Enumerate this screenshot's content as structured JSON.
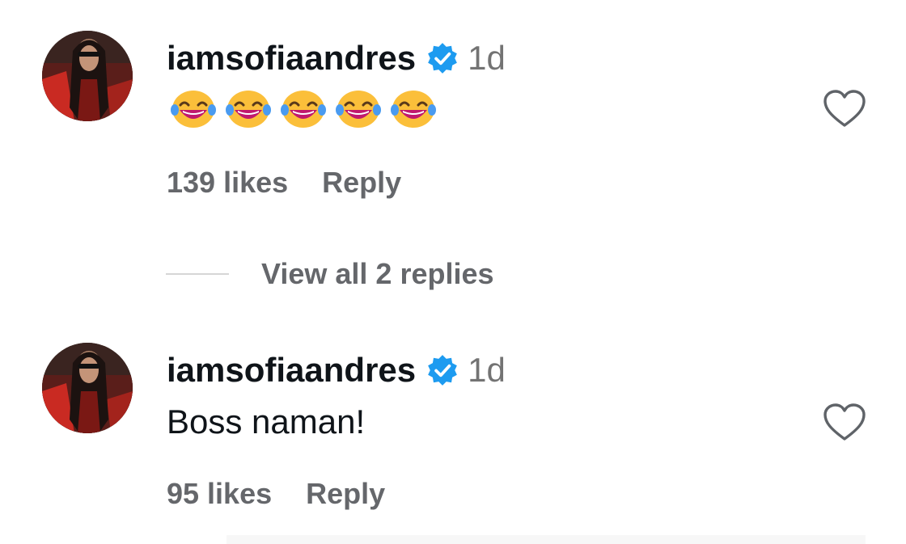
{
  "comments": [
    {
      "username": "iamsofiaandres",
      "verified": true,
      "timestamp": "1d",
      "body": "",
      "emojis": [
        "face-with-tears-of-joy",
        "face-with-tears-of-joy",
        "face-with-tears-of-joy",
        "face-with-tears-of-joy",
        "face-with-tears-of-joy"
      ],
      "likes": "139 likes",
      "reply_label": "Reply"
    },
    {
      "username": "iamsofiaandres",
      "verified": true,
      "timestamp": "1d",
      "body": "Boss naman!",
      "emojis": [],
      "likes": "95 likes",
      "reply_label": "Reply"
    }
  ],
  "view_replies": {
    "label": "View all 2 replies"
  },
  "icons": {
    "verified": "verified-badge-icon",
    "like": "heart-outline-icon",
    "emoji": "face-with-tears-of-joy"
  },
  "colors": {
    "verified_blue": "#1d9bf0",
    "text_primary": "#0f1419",
    "text_secondary": "#65676b",
    "timestamp_gray": "#737373",
    "divider": "#d6d6d6"
  }
}
